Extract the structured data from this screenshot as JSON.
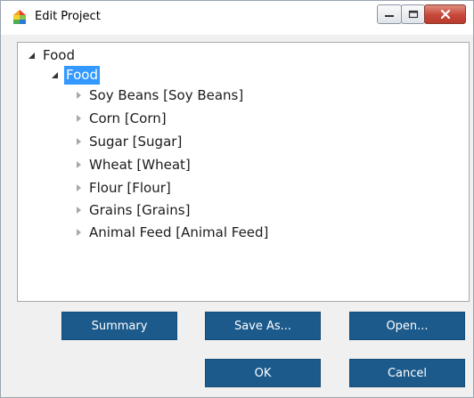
{
  "window": {
    "title": "Edit Project",
    "colors": {
      "accent": "#1c5a8c",
      "selection": "#3399ff",
      "close": "#c6483a"
    }
  },
  "tree": {
    "root": {
      "label": "Food",
      "state": "expanded"
    },
    "child": {
      "label": "Food",
      "state": "expanded",
      "selected": true
    },
    "items": [
      {
        "label": "Soy Beans [Soy Beans]",
        "state": "collapsed"
      },
      {
        "label": "Corn [Corn]",
        "state": "collapsed"
      },
      {
        "label": "Sugar [Sugar]",
        "state": "collapsed"
      },
      {
        "label": "Wheat [Wheat]",
        "state": "collapsed"
      },
      {
        "label": "Flour [Flour]",
        "state": "collapsed"
      },
      {
        "label": "Grains [Grains]",
        "state": "collapsed"
      },
      {
        "label": "Animal Feed [Animal Feed]",
        "state": "collapsed"
      }
    ]
  },
  "buttons": {
    "summary": "Summary",
    "save_as": "Save As...",
    "open": "Open...",
    "ok": "OK",
    "cancel": "Cancel"
  }
}
